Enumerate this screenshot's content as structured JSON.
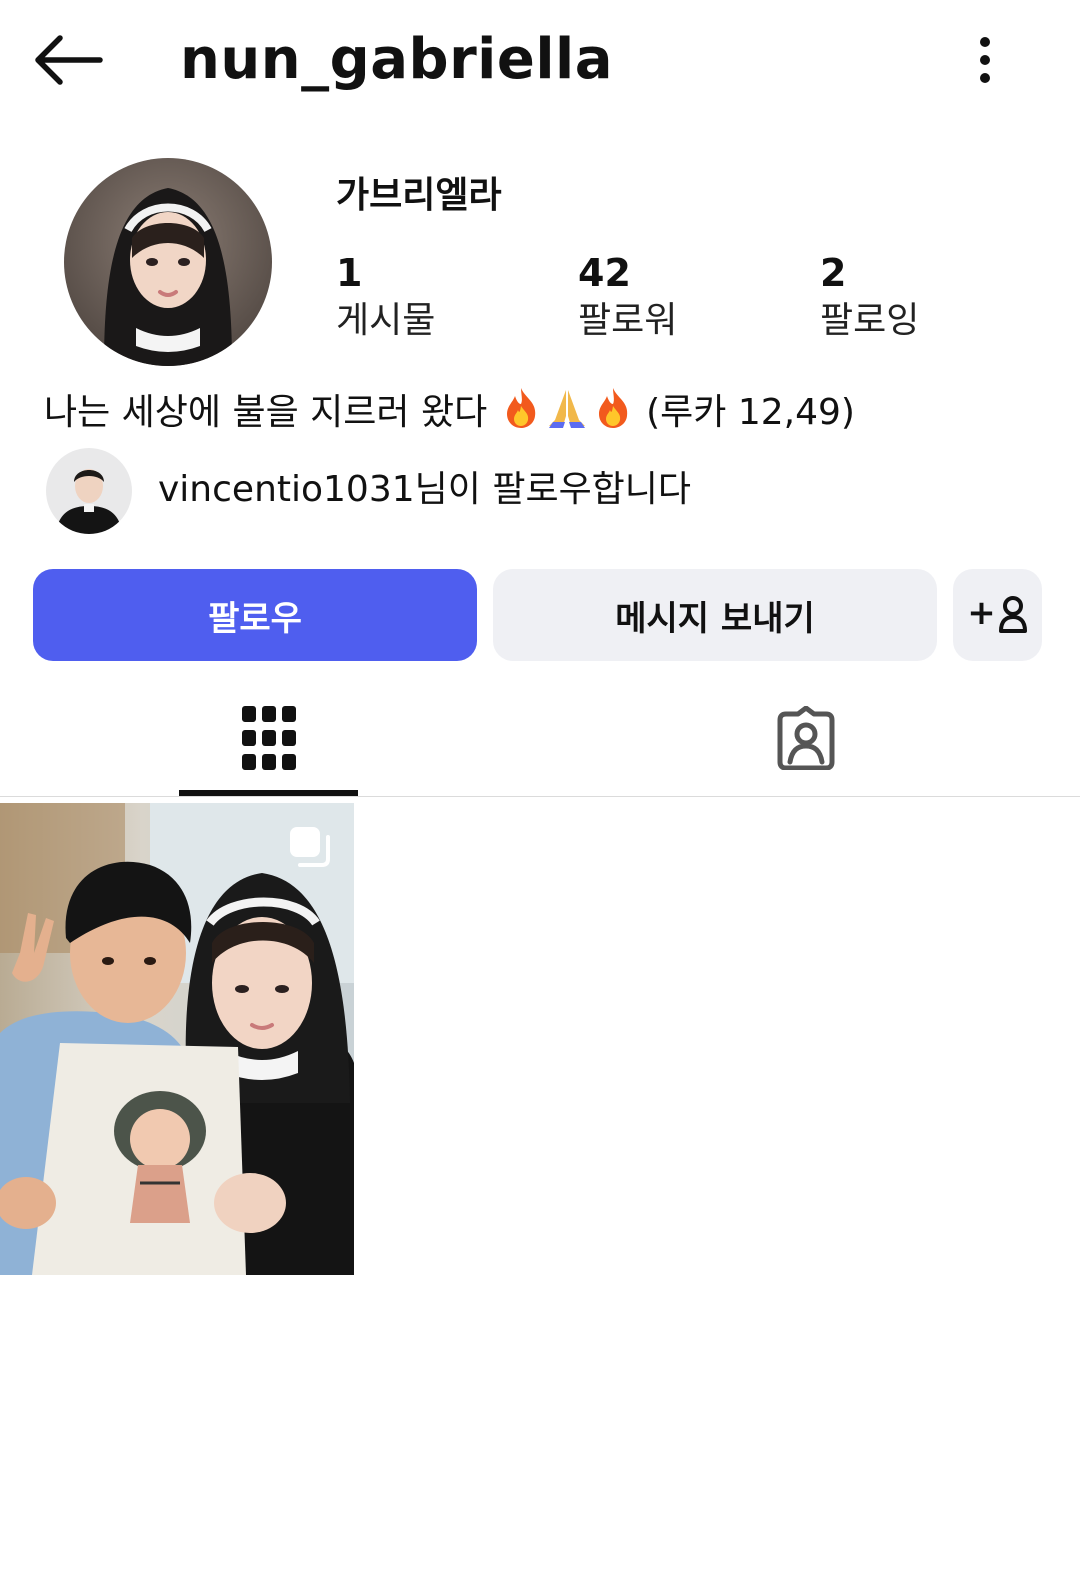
{
  "header": {
    "username": "nun_gabriella",
    "back_icon": "arrow-left-icon",
    "more_icon": "more-vertical-icon"
  },
  "profile": {
    "display_name": "가브리엘라",
    "avatar_icon": "profile-avatar",
    "stats": {
      "posts": {
        "count": "1",
        "label": "게시물"
      },
      "followers": {
        "count": "42",
        "label": "팔로워"
      },
      "following": {
        "count": "2",
        "label": "팔로잉"
      }
    },
    "bio": {
      "text": "나는 세상에 불을 지르러 왔다",
      "emojis": [
        "fire-emoji",
        "praying-hands-emoji",
        "fire-emoji"
      ],
      "reference": "(루카 12,49)"
    },
    "followed_by": {
      "text": "vincentio1031님이 팔로우합니다"
    }
  },
  "actions": {
    "follow_label": "팔로우",
    "message_label": "메시지 보내기",
    "add_user_icon": "add-user-icon",
    "add_user_label": "+"
  },
  "tabs": [
    {
      "name": "posts-grid",
      "icon": "grid-icon",
      "active": true
    },
    {
      "name": "tagged",
      "icon": "tagged-person-icon",
      "active": false
    }
  ],
  "posts": [
    {
      "icon": "multi-photo-icon"
    }
  ],
  "colors": {
    "accent": "#4f5eef",
    "secondary_button": "#eff0f4",
    "text": "#111111"
  }
}
